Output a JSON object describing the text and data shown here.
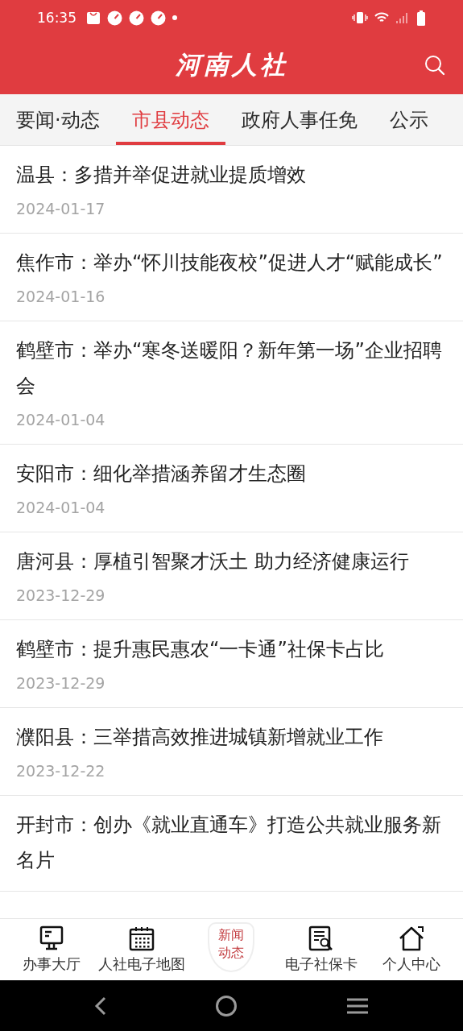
{
  "status_bar": {
    "time": "16:35"
  },
  "header": {
    "title": "河南人社"
  },
  "tabs": [
    {
      "label": "要闻·动态",
      "selected": false
    },
    {
      "label": "市县动态",
      "selected": true
    },
    {
      "label": "政府人事任免",
      "selected": false
    },
    {
      "label": "公示",
      "selected": false
    }
  ],
  "articles": [
    {
      "title": "温县：多措并举促进就业提质增效",
      "date": "2024-01-17"
    },
    {
      "title": "焦作市：举办“怀川技能夜校”促进人才“赋能成长”",
      "date": "2024-01-16"
    },
    {
      "title": "鹤壁市：举办“寒冬送暖阳？新年第一场”企业招聘会",
      "date": "2024-01-04"
    },
    {
      "title": "安阳市：细化举措涵养留才生态圈",
      "date": "2024-01-04"
    },
    {
      "title": "唐河县：厚植引智聚才沃土 助力经济健康运行",
      "date": "2023-12-29"
    },
    {
      "title": "鹤壁市：提升惠民惠农“一卡通”社保卡占比",
      "date": "2023-12-29"
    },
    {
      "title": "濮阳县：三举措高效推进城镇新增就业工作",
      "date": "2023-12-22"
    },
    {
      "title": "开封市：创办《就业直通车》打造公共就业服务新名片"
    }
  ],
  "bottom_nav": [
    {
      "label": "办事大厅",
      "kind": "monitor",
      "selected": false
    },
    {
      "label": "人社电子地图",
      "kind": "calendar",
      "selected": false
    },
    {
      "label": "新闻动态",
      "kind": "shield",
      "selected": true
    },
    {
      "label": "电子社保卡",
      "kind": "document",
      "selected": false
    },
    {
      "label": "个人中心",
      "kind": "house",
      "selected": false
    }
  ]
}
